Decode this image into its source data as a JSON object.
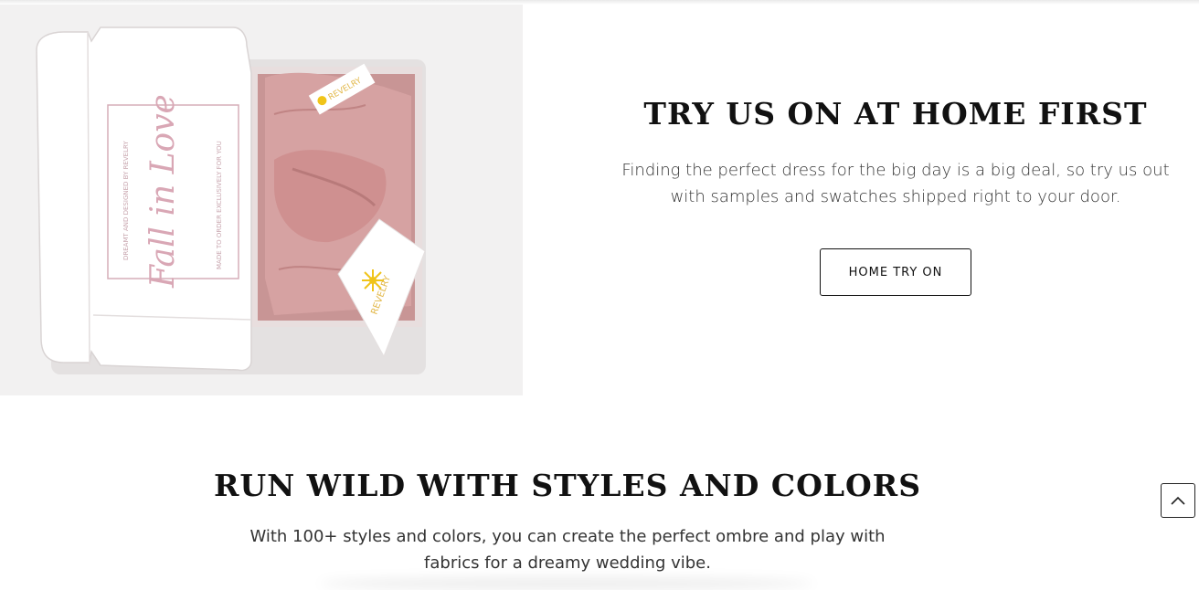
{
  "try_section": {
    "title": "TRY US ON AT HOME FIRST",
    "description": "Finding the perfect dress for the big day is a big deal, so try us out with samples and swatches shipped right to your door.",
    "button_label": "HOME TRY ON"
  },
  "run_section": {
    "title": "RUN WILD WITH STYLES AND COLORS",
    "description": "With 100+ styles and colors, you can create the perfect ombre and play with fabrics for a dreamy wedding vibe."
  },
  "hero_image": {
    "box_script": "Fall in Love",
    "box_left_text": "DREAMT AND DESIGNED BY REVELRY",
    "box_right_text": "MADE TO ORDER EXCLUSIVELY FOR YOU",
    "tag_brand": "REVELRY",
    "brand_color": "#f0c419",
    "fabric_color": "#d8a0a0"
  },
  "icons": {
    "scroll_top": "chevron-up-icon"
  }
}
